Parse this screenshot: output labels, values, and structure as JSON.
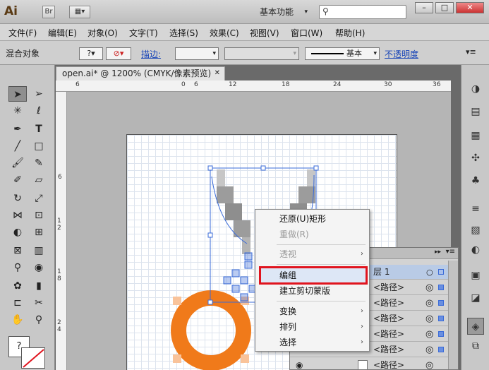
{
  "app": {
    "logo": "Ai",
    "bridge_btn": "Br",
    "workspace": "基本功能"
  },
  "menus": [
    "文件(F)",
    "编辑(E)",
    "对象(O)",
    "文字(T)",
    "选择(S)",
    "效果(C)",
    "视图(V)",
    "窗口(W)",
    "帮助(H)"
  ],
  "control": {
    "selection_type": "混合对象",
    "stroke_label": "描边:",
    "stroke_style": "基本",
    "opacity_label": "不透明度"
  },
  "document": {
    "tab_title": "open.ai* @ 1200% (CMYK/像素预览)",
    "ruler_h": [
      "6",
      "0",
      "6",
      "12",
      "18",
      "24",
      "30",
      "36"
    ],
    "ruler_v": [
      "6",
      "1 2",
      "1 8",
      "2 4"
    ]
  },
  "context_menu": {
    "items": [
      {
        "label": "还原(U)矩形",
        "enabled": true,
        "submenu": false
      },
      {
        "label": "重做(R)",
        "enabled": false,
        "submenu": false
      },
      {
        "label": "透视",
        "enabled": false,
        "submenu": true
      },
      {
        "label": "编组",
        "enabled": true,
        "submenu": false,
        "highlighted": true
      },
      {
        "label": "建立剪切蒙版",
        "enabled": true,
        "submenu": false
      },
      {
        "label": "变换",
        "enabled": true,
        "submenu": true
      },
      {
        "label": "排列",
        "enabled": true,
        "submenu": true
      },
      {
        "label": "选择",
        "enabled": true,
        "submenu": true
      }
    ]
  },
  "layers": {
    "layer_name": "层 1",
    "sublayers": [
      "<路径>",
      "<路径>",
      "<路径>",
      "<路径>",
      "<路径>",
      "<路径>"
    ]
  },
  "colors": {
    "highlight_border": "#e0141e",
    "selection_blue": "#3a6bd8",
    "orange": "#f07a1a",
    "grey_pixel": "#9c9c9c"
  }
}
